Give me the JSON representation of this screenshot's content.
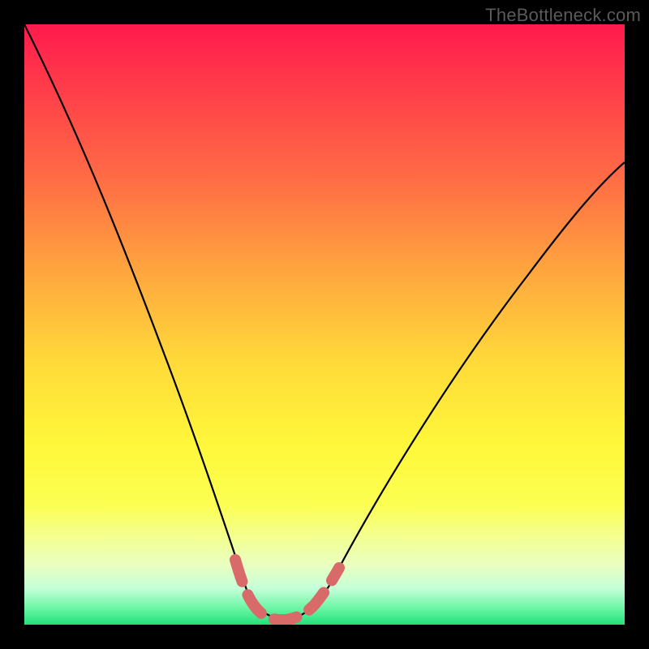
{
  "watermark": "TheBottleneck.com",
  "chart_data": {
    "type": "line",
    "title": "",
    "xlabel": "",
    "ylabel": "",
    "xlim": [
      0,
      1
    ],
    "ylim": [
      0,
      1
    ],
    "series": [
      {
        "name": "bottleneck_curve",
        "x": [
          0.0,
          0.05,
          0.1,
          0.15,
          0.2,
          0.25,
          0.3,
          0.35,
          0.38,
          0.42,
          0.46,
          0.5,
          0.55,
          0.6,
          0.7,
          0.8,
          0.9,
          1.0
        ],
        "y": [
          1.0,
          0.87,
          0.74,
          0.62,
          0.49,
          0.37,
          0.25,
          0.12,
          0.045,
          0.01,
          0.01,
          0.03,
          0.095,
          0.17,
          0.33,
          0.48,
          0.61,
          0.705
        ]
      },
      {
        "name": "optimal_zone_highlight",
        "x": [
          0.35,
          0.38,
          0.42,
          0.46,
          0.5
        ],
        "y": [
          0.12,
          0.045,
          0.01,
          0.01,
          0.03
        ]
      }
    ],
    "background": "rainbow_vertical_gradient_red_to_green",
    "annotations": [
      {
        "text": "TheBottleneck.com",
        "role": "watermark",
        "position": "top-right"
      }
    ]
  },
  "colors": {
    "curve": "#000000",
    "highlight": "#d86a6a",
    "frame": "#000000"
  }
}
